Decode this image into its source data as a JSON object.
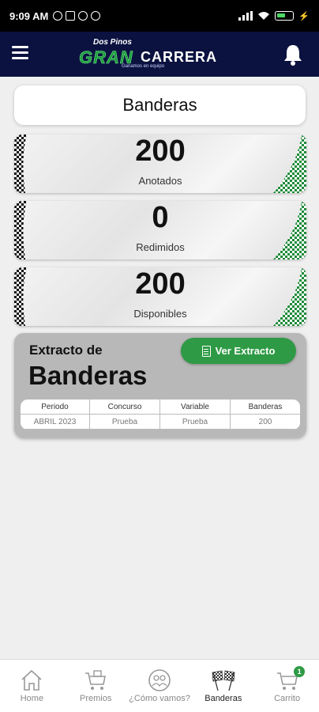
{
  "status_bar": {
    "time": "9:09 AM",
    "battery": "88"
  },
  "header": {
    "logo_top": "Dos Pinos",
    "logo_gran": "GRAN",
    "logo_carrera": "CARRERA",
    "logo_tagline": "Ganamos en equipo"
  },
  "page": {
    "title": "Banderas"
  },
  "stats": [
    {
      "value": "200",
      "label": "Anotados"
    },
    {
      "value": "0",
      "label": "Redimidos"
    },
    {
      "value": "200",
      "label": "Disponibles"
    }
  ],
  "extract": {
    "title_line1": "Extracto de",
    "title_line2": "Banderas",
    "button_label": "Ver Extracto",
    "headers": [
      "Periodo",
      "Concurso",
      "Variable",
      "Banderas"
    ],
    "row": [
      "ABRIL 2023",
      "Prueba",
      "Prueba",
      "200"
    ]
  },
  "bottom_nav": {
    "items": [
      {
        "label": "Home",
        "icon": "home-icon"
      },
      {
        "label": "Premios",
        "icon": "gift-cart-icon"
      },
      {
        "label": "¿Cómo vamos?",
        "icon": "people-icon"
      },
      {
        "label": "Banderas",
        "icon": "checkered-flags-icon"
      },
      {
        "label": "Carrito",
        "icon": "cart-icon"
      }
    ],
    "active_index": 3,
    "cart_count": "1"
  },
  "colors": {
    "navy": "#0b1240",
    "green": "#2e9a45",
    "background": "#efefef"
  }
}
